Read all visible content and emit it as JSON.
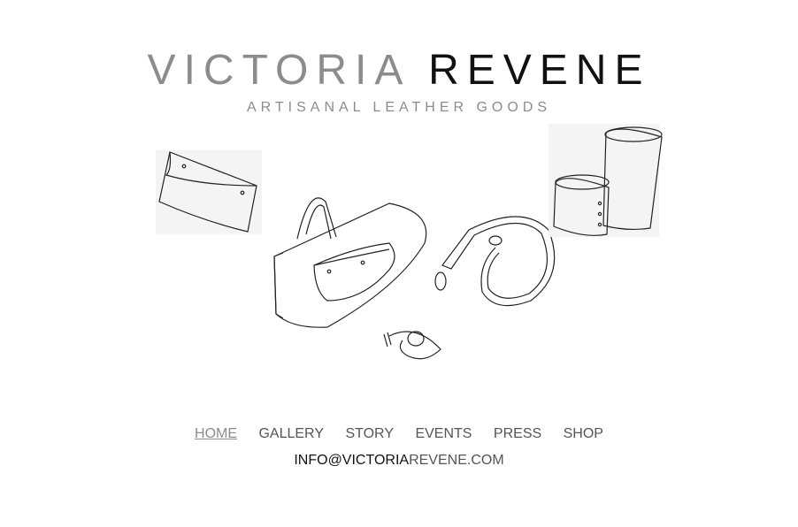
{
  "brand": {
    "name_first": "VICTORIA",
    "name_second": "REVENE",
    "tagline": "ARTISANAL LEATHER GOODS"
  },
  "illustration": {
    "icon": "leather-goods-sketch"
  },
  "nav": {
    "items": [
      {
        "label": "HOME",
        "active": true
      },
      {
        "label": "GALLERY",
        "active": false
      },
      {
        "label": "STORY",
        "active": false
      },
      {
        "label": "EVENTS",
        "active": false
      },
      {
        "label": "PRESS",
        "active": false
      },
      {
        "label": "SHOP",
        "active": false
      }
    ]
  },
  "contact": {
    "email_part1": "INFO@VICTORIA",
    "email_part2": "REVENE.COM"
  },
  "colors": {
    "grey": "#8c8c8c",
    "dark": "#111111",
    "nav": "#555555"
  }
}
